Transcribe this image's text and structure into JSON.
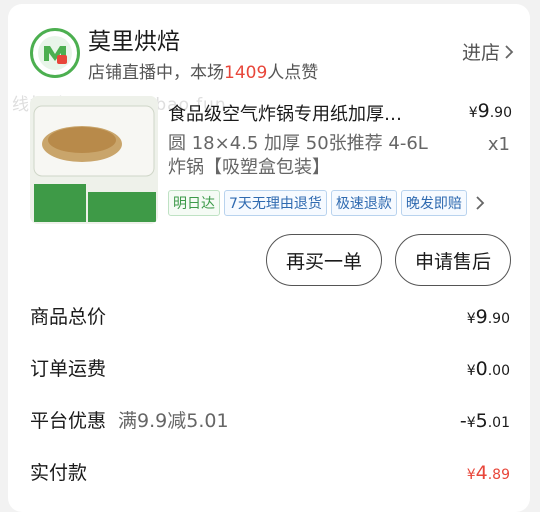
{
  "shop": {
    "name": "莫里烘焙",
    "live_prefix": "店铺直播中，本场",
    "live_count": "1409",
    "live_suffix": "人点赞",
    "enter_label": "进店",
    "watermark": "线报酷 new.xianbao.fun"
  },
  "product": {
    "title": "食品级空气炸锅专用纸加厚…",
    "price_currency": "¥",
    "price_int": "9",
    "price_dec": ".90",
    "spec": "圆 18×4.5 加厚 50张推荐 4-6L炸锅【吸塑盒包装】",
    "qty": "x1",
    "tags": [
      "明日达",
      "7天无理由退货",
      "极速退款",
      "晚发即赔"
    ]
  },
  "buttons": {
    "rebuy": "再买一单",
    "after_sale": "申请售后"
  },
  "summary": {
    "total_label": "商品总价",
    "total_currency": "¥",
    "total_int": "9",
    "total_dec": ".90",
    "shipping_label": "订单运费",
    "shipping_currency": "¥",
    "shipping_int": "0",
    "shipping_dec": ".00",
    "discount_label": "平台优惠",
    "discount_note": "满9.9减5.01",
    "discount_prefix": "-",
    "discount_currency": "¥",
    "discount_int": "5",
    "discount_dec": ".01",
    "paid_label": "实付款",
    "paid_currency": "¥",
    "paid_int": "4",
    "paid_dec": ".89"
  },
  "colors": {
    "accent_red": "#e8463a",
    "logo_green": "#4caf50",
    "tag_blue": "#2f6ab0",
    "tag_green": "#3d9a4a"
  }
}
